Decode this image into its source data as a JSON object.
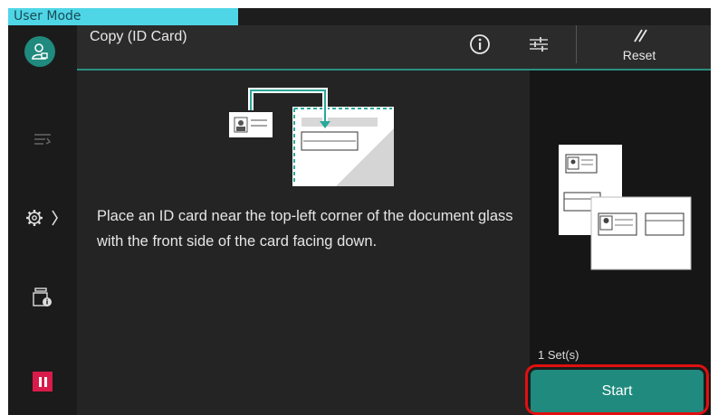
{
  "mode_tab": "User Mode",
  "header": {
    "title": "Copy (ID Card)",
    "reset_label": "Reset"
  },
  "main": {
    "instruction": "Place an ID card near the top-left corner of the document glass with the front side of the card facing down."
  },
  "right_panel": {
    "sets_label": "1 Set(s)",
    "start_label": "Start"
  },
  "colors": {
    "accent": "#1f8a7d",
    "mode_tab": "#4fd6e6",
    "highlight": "#e01010",
    "pause": "#d81b4a"
  },
  "icons": {
    "user": "user-icon",
    "info": "info-icon",
    "adjust": "sliders-icon",
    "reset": "reset-icon",
    "job": "job-flow-icon",
    "settings": "gear-icon",
    "status": "machine-status-icon",
    "pause": "pause-icon"
  }
}
